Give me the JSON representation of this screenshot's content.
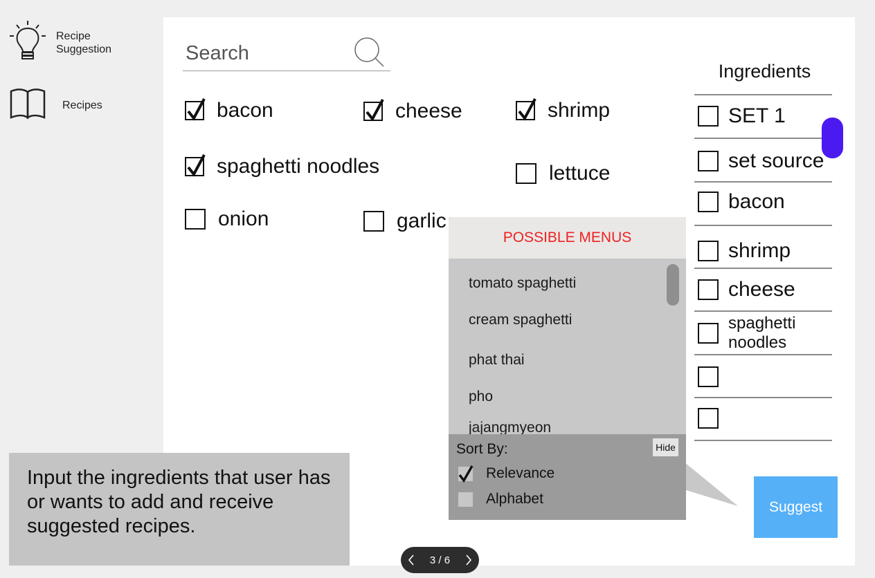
{
  "nav": {
    "items": [
      {
        "label": "Recipe\nSuggestion",
        "icon": "lightbulb-icon"
      },
      {
        "label": "Recipes",
        "icon": "book-icon"
      }
    ]
  },
  "search": {
    "placeholder": "Search",
    "value": ""
  },
  "ingredients_grid": [
    {
      "label": "bacon",
      "checked": true
    },
    {
      "label": "cheese",
      "checked": true
    },
    {
      "label": "shrimp",
      "checked": true
    },
    {
      "label": "spaghetti noodles",
      "checked": true
    },
    {
      "label": "lettuce",
      "checked": false
    },
    {
      "label": "onion",
      "checked": false
    },
    {
      "label": "garlic",
      "checked": false
    }
  ],
  "ingredients_panel": {
    "header": "Ingredients",
    "items": [
      {
        "label": "SET 1",
        "checked": false
      },
      {
        "label": "set source",
        "checked": false
      },
      {
        "label": "bacon",
        "checked": false
      },
      {
        "label": "shrimp",
        "checked": false
      },
      {
        "label": "cheese",
        "checked": false
      },
      {
        "label": "spaghetti noodles",
        "checked": false
      },
      {
        "label": "",
        "checked": false
      },
      {
        "label": "",
        "checked": false
      }
    ]
  },
  "popup": {
    "title": "POSSIBLE MENUS",
    "menus": [
      "tomato spaghetti",
      "cream spaghetti",
      "phat thai",
      "pho",
      "jajangmyeon"
    ],
    "sort": {
      "title": "Sort By:",
      "hide_label": "Hide",
      "options": [
        {
          "label": "Relevance",
          "checked": true
        },
        {
          "label": "Alphabet",
          "checked": false
        }
      ]
    }
  },
  "suggest_label": "Suggest",
  "note": "Input the ingredients that user has or wants to add and receive suggested recipes.",
  "pager": {
    "text": "3 / 6"
  },
  "colors": {
    "accent": "#55b0f7",
    "scrollbar": "#4a1af0",
    "title_red": "#ee2222"
  }
}
